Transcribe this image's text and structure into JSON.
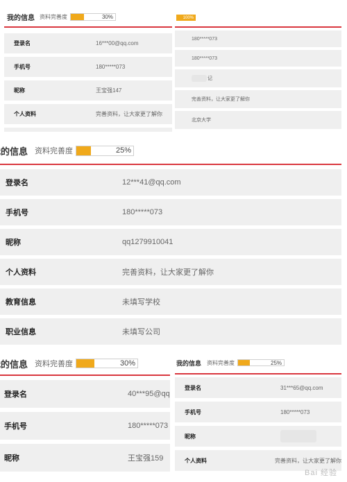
{
  "panels": {
    "tl": {
      "title": "我的信息",
      "completeness_label": "资料完善度",
      "completeness_pct": "30%",
      "completeness_value": 0.3,
      "rows": [
        {
          "label": "登录名",
          "value": "16***00@qq.com"
        },
        {
          "label": "手机号",
          "value": "180*****073"
        },
        {
          "label": "昵称",
          "value": "王宝强147"
        },
        {
          "label": "个人资料",
          "value": "完善资料，让大家更了解你"
        }
      ]
    },
    "tr": {
      "completeness_pct": "100%",
      "completeness_value": 1.0,
      "rows": [
        {
          "value": "180*****073"
        },
        {
          "value": "180*****073"
        },
        {
          "value": "记"
        },
        {
          "value": "完善资料，让大家更了解你"
        },
        {
          "value": "北京大学"
        }
      ]
    },
    "mid": {
      "title": "我的信息",
      "completeness_label": "资料完善度",
      "completeness_pct": "25%",
      "completeness_value": 0.25,
      "rows": [
        {
          "label": "登录名",
          "value": "12***41@qq.com"
        },
        {
          "label": "手机号",
          "value": "180*****073"
        },
        {
          "label": "昵称",
          "value": "qq1279910041"
        },
        {
          "label": "个人资料",
          "value": "完善资料，让大家更了解你"
        },
        {
          "label": "教育信息",
          "value": "未填写学校"
        },
        {
          "label": "职业信息",
          "value": "未填写公司"
        }
      ]
    },
    "bl": {
      "title": "我的信息",
      "completeness_label": "资料完善度",
      "completeness_pct": "30%",
      "completeness_value": 0.3,
      "rows": [
        {
          "label": "登录名",
          "value": "40***95@qq"
        },
        {
          "label": "手机号",
          "value": "180*****073"
        },
        {
          "label": "昵称",
          "value": "王宝强159"
        }
      ]
    },
    "br": {
      "title": "我的信息",
      "completeness_label": "资料完善度",
      "completeness_pct": "25%",
      "completeness_value": 0.25,
      "rows": [
        {
          "label": "登录名",
          "value": "31***65@qq.com"
        },
        {
          "label": "手机号",
          "value": "180*****073"
        },
        {
          "label": "昵称",
          "value": ""
        },
        {
          "label": "个人资料",
          "value": "完善资料，让大家更了解你"
        }
      ]
    }
  },
  "watermark": "Bai 经验",
  "colors": {
    "accent_red": "#d9363e",
    "progress_orange": "#f0a91b",
    "row_bg": "#efefef"
  }
}
